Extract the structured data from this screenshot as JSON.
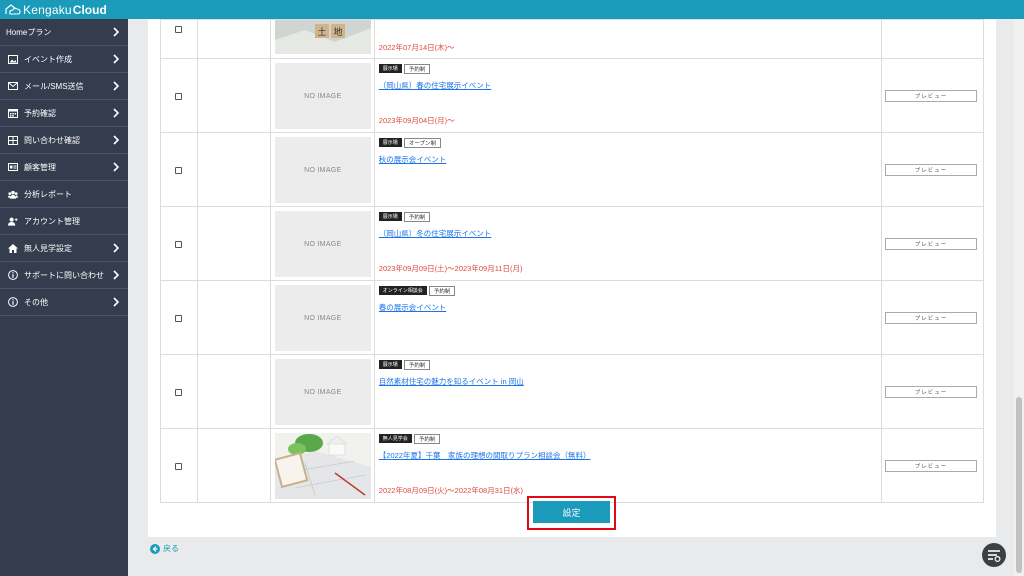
{
  "header": {
    "logo_part1": "Kengaku",
    "logo_part2": "Cloud"
  },
  "sidebar": {
    "items": [
      {
        "label": "Homeプラン",
        "icon": "none",
        "has_chevron": true
      },
      {
        "label": "イベント作成",
        "icon": "image-icon",
        "has_chevron": true
      },
      {
        "label": "メール/SMS送信",
        "icon": "mail-icon",
        "has_chevron": true
      },
      {
        "label": "予約確認",
        "icon": "calendar-icon",
        "has_chevron": true
      },
      {
        "label": "問い合わせ確認",
        "icon": "inbox-icon",
        "has_chevron": true
      },
      {
        "label": "顧客管理",
        "icon": "id-card-icon",
        "has_chevron": true
      },
      {
        "label": "分析レポート",
        "icon": "users-icon",
        "has_chevron": false
      },
      {
        "label": "アカウント管理",
        "icon": "user-plus-icon",
        "has_chevron": false
      },
      {
        "label": "無人見学設定",
        "icon": "home-icon",
        "has_chevron": true
      },
      {
        "label": "サポートに問い合わせ",
        "icon": "info-icon",
        "has_chevron": true
      },
      {
        "label": "その他",
        "icon": "info-icon",
        "has_chevron": true
      }
    ]
  },
  "events": {
    "preview_label": "プレビュー",
    "no_image_label": "NO IMAGE",
    "first_row_date": "2022年07月14日(木)～",
    "rows": [
      {
        "badge_dark": "展示場",
        "badge_light": "予約制",
        "title": "（岡山県）春の住宅展示イベント",
        "date": "2023年09月04日(月)～"
      },
      {
        "badge_dark": "展示場",
        "badge_light": "オープン制",
        "title": "秋の展示会イベント",
        "date": ""
      },
      {
        "badge_dark": "展示場",
        "badge_light": "予約制",
        "title": "（岡山県）冬の住宅展示イベント",
        "date": "2023年09月09日(土)～2023年09月11日(月)"
      },
      {
        "badge_dark": "オンライン相談会",
        "badge_light": "予約制",
        "title": "春の展示会イベント",
        "date": ""
      },
      {
        "badge_dark": "展示場",
        "badge_light": "予約制",
        "title": "自然素材住宅の魅力を知るイベント in 岡山",
        "date": ""
      },
      {
        "badge_dark": "無人見学会",
        "badge_light": "予約制",
        "title": "【2022年夏】千葉　家族の理想の間取りプラン相談会（無料）",
        "date": "2022年08月09日(火)～2022年08月31日(水)"
      }
    ]
  },
  "actions": {
    "set_label": "設定",
    "back_label": "戻る"
  },
  "colors": {
    "brand": "#1a9bb9",
    "sidebar_bg": "#343c4d",
    "date_red": "#e0493e",
    "link_blue": "#1a73e8",
    "highlight_red": "#e30613"
  }
}
